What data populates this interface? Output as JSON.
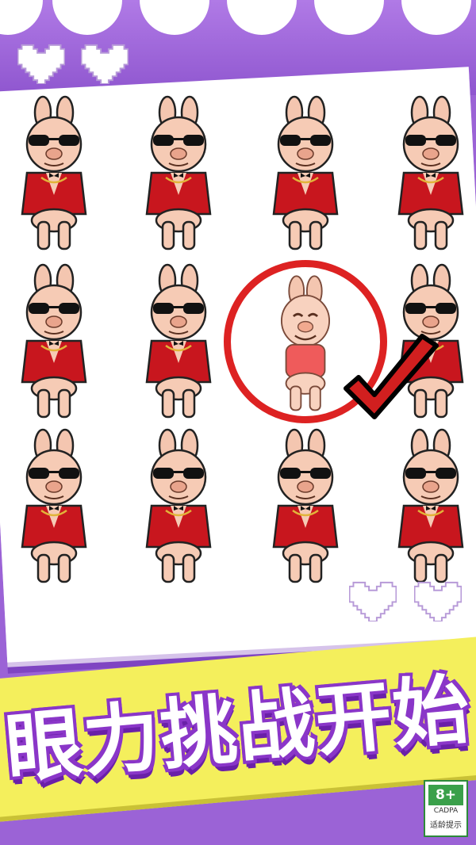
{
  "colors": {
    "background_purple": "#9b63d6",
    "banner_yellow": "#f4ef5c",
    "title_outline_purple": "#8a36c8",
    "answer_red": "#dd2222"
  },
  "grid": {
    "rows": 3,
    "cols": 4,
    "pig_variant": "cool-pig-sunglasses-red-jacket",
    "odd_one_out": {
      "row": 2,
      "col": 3,
      "variant": "smiling-pig-red-tshirt",
      "marked": "correct-checkmark"
    }
  },
  "title": {
    "text": "眼力挑战开始"
  },
  "age_rating": {
    "age": "8+",
    "org": "CADPA",
    "tip": "适龄提示"
  }
}
